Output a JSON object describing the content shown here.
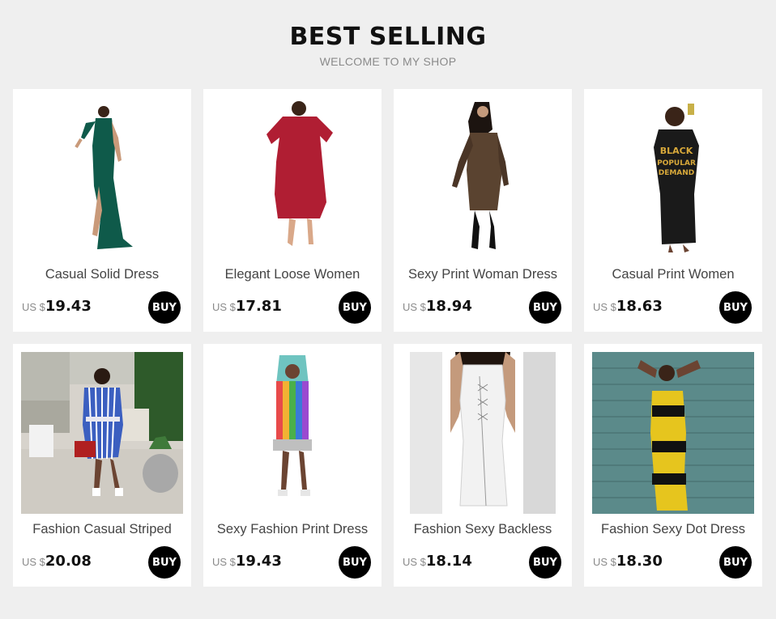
{
  "header": {
    "title": "BEST SELLING",
    "subtitle": "WELCOME TO MY SHOP"
  },
  "products": [
    {
      "name": "Casual Solid Dress",
      "currency": "US $",
      "price": "19.43",
      "buy": "BUY",
      "image": "woman-in-green-maxi-dress",
      "color": "#0f5a4a"
    },
    {
      "name": "Elegant Loose Women",
      "currency": "US $",
      "price": "17.81",
      "buy": "BUY",
      "image": "woman-in-red-wrap-dress",
      "color": "#b01e33"
    },
    {
      "name": "Sexy Print Woman Dress",
      "currency": "US $",
      "price": "18.94",
      "buy": "BUY",
      "image": "woman-in-print-bodycon-dress",
      "color": "#5a4330"
    },
    {
      "name": "Casual Print Women",
      "currency": "US $",
      "price": "18.63",
      "buy": "BUY",
      "image": "woman-in-black-tshirt-dress",
      "color": "#1a1a1a"
    },
    {
      "name": "Fashion Casual Striped",
      "currency": "US $",
      "price": "20.08",
      "buy": "BUY",
      "image": "woman-in-striped-shirt-dress",
      "color": "#3b5fc0"
    },
    {
      "name": "Sexy Fashion Print Dress",
      "currency": "US $",
      "price": "19.43",
      "buy": "BUY",
      "image": "woman-in-rainbow-stripe-dress",
      "color": "#e8a040"
    },
    {
      "name": "Fashion Sexy Backless",
      "currency": "US $",
      "price": "18.14",
      "buy": "BUY",
      "image": "woman-in-white-lace-up-dress",
      "color": "#f2f2f2"
    },
    {
      "name": "Fashion Sexy Dot Dress",
      "currency": "US $",
      "price": "18.30",
      "buy": "BUY",
      "image": "woman-in-yellow-dot-dress",
      "color": "#e6c51e"
    }
  ]
}
